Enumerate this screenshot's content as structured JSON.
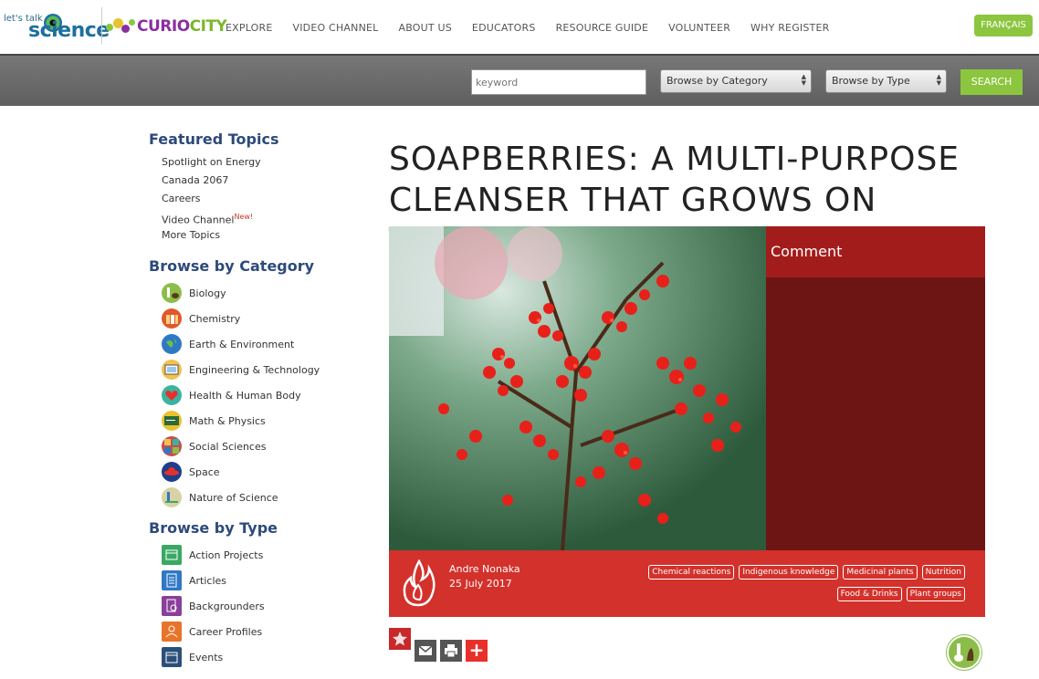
{
  "header": {
    "logo_lts_small": "let's talk",
    "logo_lts_big": "science",
    "logo_curio_a": "CURIO",
    "logo_curio_b": "CITY",
    "nav": [
      "EXPLORE",
      "VIDEO CHANNEL",
      "ABOUT US",
      "EDUCATORS",
      "RESOURCE GUIDE",
      "VOLUNTEER",
      "WHY REGISTER"
    ],
    "lang_button": "FRANÇAIS"
  },
  "search": {
    "keyword_placeholder": "keyword",
    "category_select": "Browse by Category",
    "type_select": "Browse by Type",
    "button": "SEARCH"
  },
  "sidebar": {
    "featured_heading": "Featured Topics",
    "featured": [
      "Spotlight on Energy",
      "Canada 2067",
      "Careers",
      "Video Channel",
      "More Topics"
    ],
    "new_badge": "New!",
    "category_heading": "Browse by Category",
    "categories": [
      {
        "label": "Biology",
        "icon": "biology-icon",
        "color": "#8cbd4a"
      },
      {
        "label": "Chemistry",
        "icon": "chemistry-icon",
        "color": "#e2572b"
      },
      {
        "label": "Earth & Environment",
        "icon": "earth-icon",
        "color": "#2f78c4"
      },
      {
        "label": "Engineering & Technology",
        "icon": "engineering-icon",
        "color": "#f2c14e"
      },
      {
        "label": "Health & Human Body",
        "icon": "health-icon",
        "color": "#3bb3a0"
      },
      {
        "label": "Math & Physics",
        "icon": "math-icon",
        "color": "#e8c330"
      },
      {
        "label": "Social Sciences",
        "icon": "social-icon",
        "color": "#c94d4d"
      },
      {
        "label": "Space",
        "icon": "space-icon",
        "color": "#1f3f8a"
      },
      {
        "label": "Nature of Science",
        "icon": "nature-icon",
        "color": "#d9d2a4"
      }
    ],
    "type_heading": "Browse by Type",
    "types": [
      {
        "label": "Action Projects",
        "icon": "action-projects-icon",
        "color": "#3aa864"
      },
      {
        "label": "Articles",
        "icon": "articles-icon",
        "color": "#2f78c4"
      },
      {
        "label": "Backgrounders",
        "icon": "backgrounders-icon",
        "color": "#8a3f9a"
      },
      {
        "label": "Career Profiles",
        "icon": "career-icon",
        "color": "#e8742a"
      },
      {
        "label": "Events",
        "icon": "events-icon",
        "color": "#2a4f7a"
      }
    ]
  },
  "article": {
    "title": "SOAPBERRIES: A MULTI-PURPOSE CLEANSER THAT GROWS ON TREES",
    "comment_label": "Comment",
    "author": "Andre Nonaka",
    "date": "25 July 2017",
    "tags": [
      "Chemical reactions",
      "Indigenous knowledge",
      "Medicinal plants",
      "Nutrition",
      "Food & Drinks",
      "Plant groups"
    ]
  },
  "colors": {
    "accent_green": "#8cc63f",
    "meta_red": "#d3312b",
    "comment_dark": "#6d1414",
    "comment_head": "#a31c1c",
    "heading_blue": "#2d4a7a"
  }
}
